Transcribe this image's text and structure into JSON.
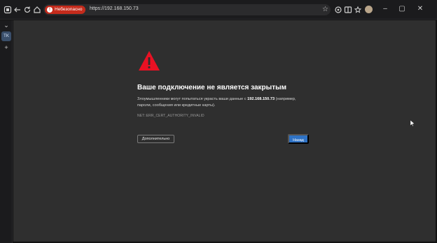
{
  "browser": {
    "security_badge": "Небезопасно",
    "url": "https://192.168.150.73"
  },
  "page": {
    "heading": "Ваше подключение не является закрытым",
    "description_pre": "Злоумышленники могут попытаться украсть ваши данные с ",
    "description_host": "192.168.150.73",
    "description_post": " (например, пароли, сообщения или кредитные карты).",
    "error_code": "NET::ERR_CERT_AUTHORITY_INVALID",
    "advanced_button": "Дополнительно",
    "back_button": "Назад"
  },
  "colors": {
    "accent": "#2f72c4",
    "warning_red": "#e81123",
    "badge_red": "#c42b1c",
    "background": "#2f2f2f"
  },
  "icons": [
    "tab-actions-icon",
    "back-arrow-icon",
    "refresh-icon",
    "home-icon",
    "warning-icon",
    "favorite-star-icon",
    "extensions-icon",
    "split-screen-icon",
    "favorites-icon",
    "profile-avatar",
    "minimize-icon",
    "maximize-icon",
    "close-icon",
    "chevron-down-icon",
    "add-tab-icon",
    "mouse-cursor"
  ]
}
